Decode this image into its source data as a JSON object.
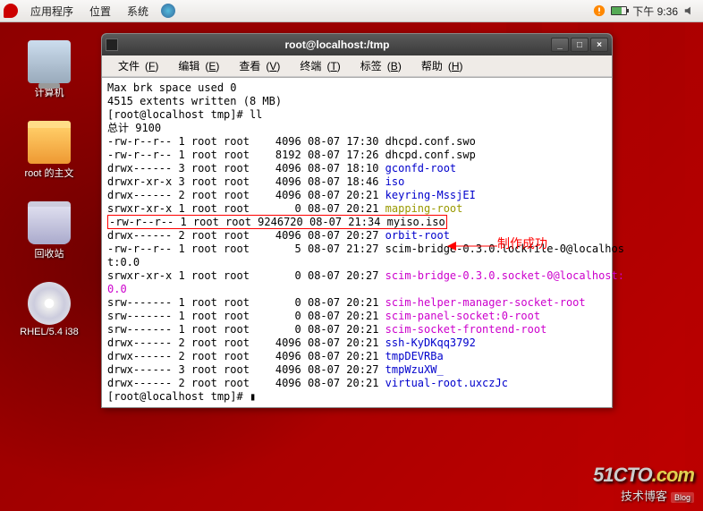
{
  "panel": {
    "menus": [
      "应用程序",
      "位置",
      "系统"
    ],
    "clock": "下午 9:36"
  },
  "desktop_icons": {
    "computer": "计算机",
    "home": "root 的主文",
    "trash": "回收站",
    "disc": "RHEL/5.4 i38"
  },
  "window": {
    "title": "root@localhost:/tmp",
    "menus": {
      "file": "文件",
      "file_u": "F",
      "edit": "编辑",
      "edit_u": "E",
      "view": "查看",
      "view_u": "V",
      "term": "终端",
      "term_u": "T",
      "tabs": "标签",
      "tabs_u": "B",
      "help": "帮助",
      "help_u": "H"
    }
  },
  "annotation": "制作成功",
  "watermark": {
    "brand": "51CTO",
    "dot": ".com",
    "sub": "技术博客",
    "blog": "Blog"
  },
  "terminal": {
    "l1": "Max brk space used 0",
    "l2": "4515 extents written (8 MB)",
    "l3": "[root@localhost tmp]# ll",
    "l4": "总计 9100",
    "rows": [
      {
        "p": "-rw-r--r--",
        "n": "1",
        "o": "root root",
        "s": "   4096",
        "d": "08-07 17:30",
        "name": "dhcpd.conf.swo",
        "c": ""
      },
      {
        "p": "-rw-r--r--",
        "n": "1",
        "o": "root root",
        "s": "   8192",
        "d": "08-07 17:26",
        "name": "dhcpd.conf.swp",
        "c": ""
      },
      {
        "p": "drwx------",
        "n": "3",
        "o": "root root",
        "s": "   4096",
        "d": "08-07 18:10",
        "name": "gconfd-root",
        "c": "c-blue"
      },
      {
        "p": "drwxr-xr-x",
        "n": "3",
        "o": "root root",
        "s": "   4096",
        "d": "08-07 18:46",
        "name": "iso",
        "c": "c-blue"
      },
      {
        "p": "drwx------",
        "n": "2",
        "o": "root root",
        "s": "   4096",
        "d": "08-07 20:21",
        "name": "keyring-MssjEI",
        "c": "c-blue"
      },
      {
        "p": "srwxr-xr-x",
        "n": "1",
        "o": "root root",
        "s": "      0",
        "d": "08-07 20:21",
        "name": "mapping-root",
        "c": "c-yellow"
      }
    ],
    "highlight": {
      "p": "-rw-r--r--",
      "n": "1",
      "o": "root root",
      "s": "9246720",
      "d": "08-07 21:34",
      "name": "myiso.iso"
    },
    "rows2": [
      {
        "p": "drwx------",
        "n": "2",
        "o": "root root",
        "s": "   4096",
        "d": "08-07 20:27",
        "name": "orbit-root",
        "c": "c-blue"
      },
      {
        "p": "-rw-r--r--",
        "n": "1",
        "o": "root root",
        "s": "      5",
        "d": "08-07 21:27",
        "name": "scim-bridge-0.3.0.lockfile-0@localhos",
        "c": ""
      }
    ],
    "wrap1": "t:0.0",
    "rows3": [
      {
        "p": "srwxr-xr-x",
        "n": "1",
        "o": "root root",
        "s": "      0",
        "d": "08-07 20:27",
        "name": "scim-bridge-0.3.0.socket-0@localhost:",
        "c": "c-mag"
      }
    ],
    "wrap2": "0.0",
    "rows4": [
      {
        "p": "srw-------",
        "n": "1",
        "o": "root root",
        "s": "      0",
        "d": "08-07 20:21",
        "name": "scim-helper-manager-socket-root",
        "c": "c-mag"
      },
      {
        "p": "srw-------",
        "n": "1",
        "o": "root root",
        "s": "      0",
        "d": "08-07 20:21",
        "name": "scim-panel-socket:0-root",
        "c": "c-mag"
      },
      {
        "p": "srw-------",
        "n": "1",
        "o": "root root",
        "s": "      0",
        "d": "08-07 20:21",
        "name": "scim-socket-frontend-root",
        "c": "c-mag"
      },
      {
        "p": "drwx------",
        "n": "2",
        "o": "root root",
        "s": "   4096",
        "d": "08-07 20:21",
        "name": "ssh-KyDKqq3792",
        "c": "c-blue"
      },
      {
        "p": "drwx------",
        "n": "2",
        "o": "root root",
        "s": "   4096",
        "d": "08-07 20:21",
        "name": "tmpDEVRBa",
        "c": "c-blue"
      },
      {
        "p": "drwx------",
        "n": "3",
        "o": "root root",
        "s": "   4096",
        "d": "08-07 20:27",
        "name": "tmpWzuXW_",
        "c": "c-blue"
      },
      {
        "p": "drwx------",
        "n": "2",
        "o": "root root",
        "s": "   4096",
        "d": "08-07 20:21",
        "name": "virtual-root.uxczJc",
        "c": "c-blue"
      }
    ],
    "prompt": "[root@localhost tmp]# ",
    "cursor": "▮"
  }
}
